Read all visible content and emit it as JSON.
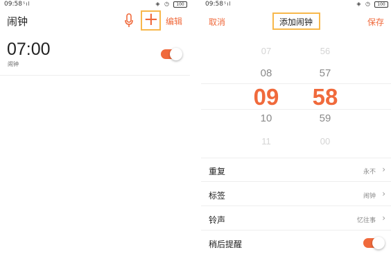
{
  "left": {
    "status": {
      "time": "09:58",
      "signal": "⁵ıl",
      "icons": "◈ ◷",
      "battery": "100"
    },
    "title": "闹钟",
    "add_symbol": "+",
    "edit_label": "编辑",
    "alarm": {
      "time": "07:00",
      "label": "闹钟",
      "enabled": true
    }
  },
  "right": {
    "status": {
      "time": "09:58",
      "signal": "⁵ıl",
      "icons": "◈ ◷",
      "battery": "100"
    },
    "cancel_label": "取消",
    "title": "添加闹钟",
    "save_label": "保存",
    "picker": {
      "hours": [
        "07",
        "08",
        "09",
        "10",
        "11"
      ],
      "minutes": [
        "56",
        "57",
        "58",
        "59",
        "00"
      ],
      "selected_hour": "09",
      "selected_minute": "58"
    },
    "settings": [
      {
        "label": "重复",
        "value": "永不"
      },
      {
        "label": "标签",
        "value": "闹钟"
      },
      {
        "label": "铃声",
        "value": "忆往事"
      },
      {
        "label": "稍后提醒",
        "value": ""
      }
    ],
    "snooze_enabled": true
  },
  "colors": {
    "accent": "#f06a3c",
    "highlight": "#f7b84b"
  },
  "icons": {
    "mic": "microphone-icon",
    "add": "plus-icon",
    "chevron": "chevron-right-icon"
  }
}
